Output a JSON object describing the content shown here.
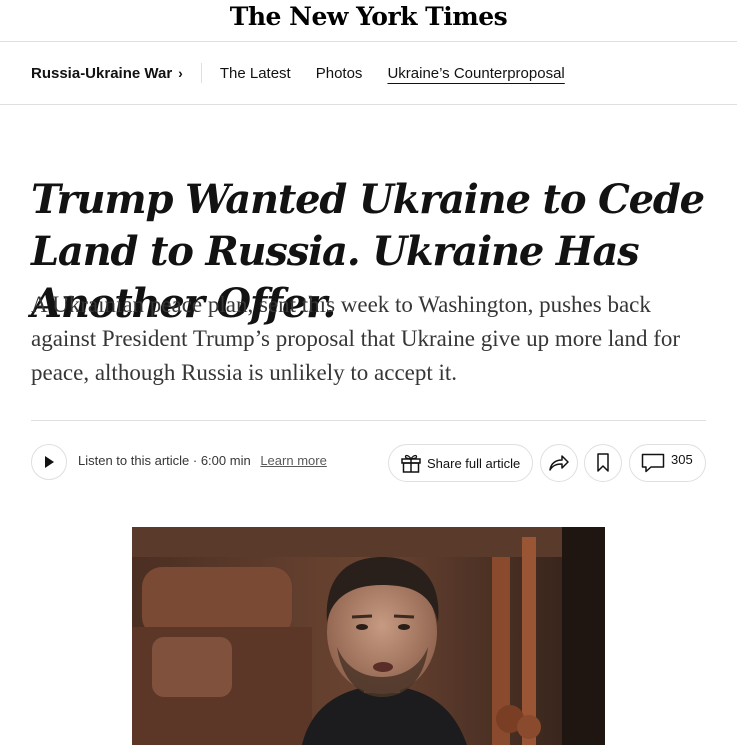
{
  "masthead": {
    "logo_text": "The New York Times"
  },
  "nav": {
    "section": "Russia-Ukraine War",
    "chevron": "›",
    "links": [
      "The Latest",
      "Photos",
      "Ukraine’s Counterproposal"
    ]
  },
  "article": {
    "headline": "Trump Wanted Ukraine to Cede Land to Russia. Ukraine Has Another Offer.",
    "summary": "A Ukrainian peace plan, sent this week to Washington, pushes back against President Trump’s proposal that Ukraine give up more land for peace, although Russia is unlikely to accept it."
  },
  "toolbar": {
    "listen_label": "Listen to this article · 6:00 min",
    "learn_more": "Learn more",
    "share_full": "Share full article",
    "comment_count": "305"
  },
  "colors": {
    "text": "#121212",
    "rule": "#dfdfdf"
  },
  "icons": [
    "play-icon",
    "gift-icon",
    "share-arrow-icon",
    "bookmark-icon",
    "comment-icon"
  ]
}
